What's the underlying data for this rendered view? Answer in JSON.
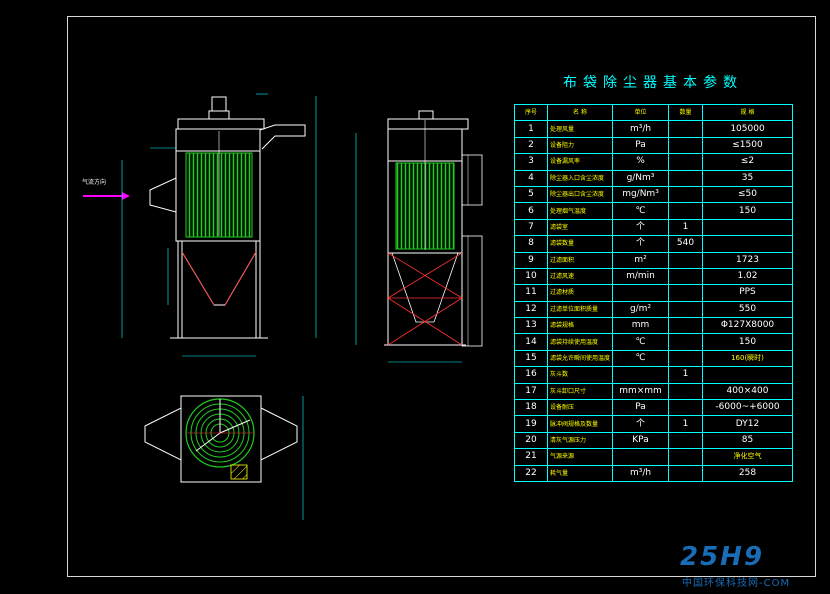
{
  "title": "布袋除尘器基本参数",
  "header": [
    "序号",
    "名 称",
    "单位",
    "数量",
    "规 格"
  ],
  "rows": [
    {
      "no": "1",
      "name": "处理风量",
      "unit": "m³/h",
      "qty": "",
      "spec": "105000"
    },
    {
      "no": "2",
      "name": "设备阻力",
      "unit": "Pa",
      "qty": "",
      "spec": "≤1500"
    },
    {
      "no": "3",
      "name": "设备漏风率",
      "unit": "%",
      "qty": "",
      "spec": "≤2"
    },
    {
      "no": "4",
      "name": "除尘器入口含尘浓度",
      "unit": "g/Nm³",
      "qty": "",
      "spec": "35"
    },
    {
      "no": "5",
      "name": "除尘器出口含尘浓度",
      "unit": "mg/Nm³",
      "qty": "",
      "spec": "≤50"
    },
    {
      "no": "6",
      "name": "处理烟气温度",
      "unit": "℃",
      "qty": "",
      "spec": "150"
    },
    {
      "no": "7",
      "name": "滤袋室",
      "unit": "个",
      "qty": "1",
      "spec": ""
    },
    {
      "no": "8",
      "name": "滤袋数量",
      "unit": "个",
      "qty": "540",
      "spec": ""
    },
    {
      "no": "9",
      "name": "过滤面积",
      "unit": "m²",
      "qty": "",
      "spec": "1723"
    },
    {
      "no": "10",
      "name": "过滤风速",
      "unit": "m/min",
      "qty": "",
      "spec": "1.02"
    },
    {
      "no": "11",
      "name": "过滤材质",
      "unit": "",
      "qty": "",
      "spec": "PPS"
    },
    {
      "no": "12",
      "name": "过滤单位面积质量",
      "unit": "g/m²",
      "qty": "",
      "spec": "550"
    },
    {
      "no": "13",
      "name": "滤袋规格",
      "unit": "mm",
      "qty": "",
      "spec": "Φ127X8000"
    },
    {
      "no": "14",
      "name": "滤袋持续使用温度",
      "unit": "℃",
      "qty": "",
      "spec": "150"
    },
    {
      "no": "15",
      "name": "滤袋允许瞬间使用温度",
      "unit": "℃",
      "qty": "",
      "spec": "160(瞬时)"
    },
    {
      "no": "16",
      "name": "灰斗数",
      "unit": "",
      "qty": "1",
      "spec": ""
    },
    {
      "no": "17",
      "name": "灰斗卸口尺寸",
      "unit": "mm×mm",
      "qty": "",
      "spec": "400×400"
    },
    {
      "no": "18",
      "name": "设备耐压",
      "unit": "Pa",
      "qty": "",
      "spec": "-6000~+6000"
    },
    {
      "no": "19",
      "name": "脉冲阀规格及数量",
      "unit": "个",
      "qty": "1",
      "spec": "DY12"
    },
    {
      "no": "20",
      "name": "清灰气源压力",
      "unit": "KPa",
      "qty": "",
      "spec": "85"
    },
    {
      "no": "21",
      "name": "气源来源",
      "unit": "",
      "qty": "",
      "spec": "净化空气"
    },
    {
      "no": "22",
      "name": "耗气量",
      "unit": "m³/h",
      "qty": "",
      "spec": "258"
    }
  ],
  "annotations": {
    "airflow": "气流方向"
  },
  "watermark": {
    "logo": "25H9",
    "text": "中国环保科技网-COM"
  },
  "colors": {
    "background": "#000000",
    "outline": "#ffffff",
    "filter_bags": "#22cc22",
    "dimension": "#00ffff",
    "bracing": "#ff3030",
    "callout": "#ffff00",
    "arrow": "#ff00ff"
  }
}
